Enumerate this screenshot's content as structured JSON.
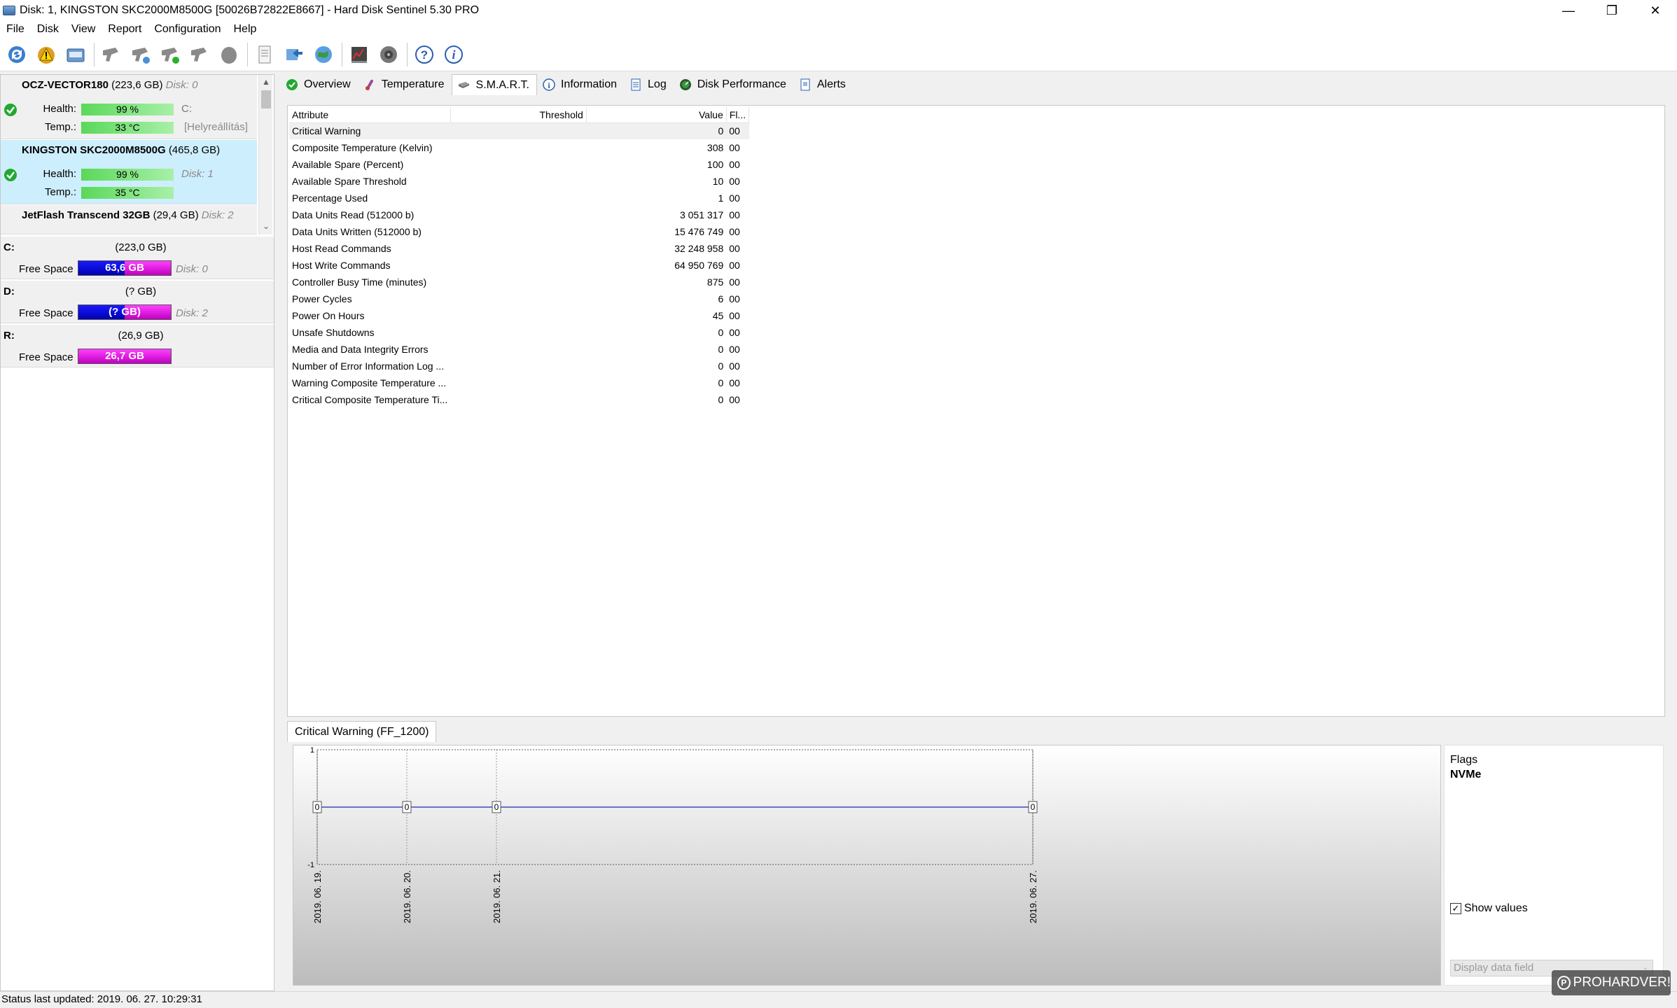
{
  "window": {
    "title": "Disk: 1, KINGSTON SKC2000M8500G [50026B72822E8667]  -  Hard Disk Sentinel 5.30 PRO",
    "minimize": "—",
    "restore": "❐",
    "close": "✕"
  },
  "menu": [
    "File",
    "Disk",
    "View",
    "Report",
    "Configuration",
    "Help"
  ],
  "toolbar_icons": [
    "refresh-icon",
    "warning-icon",
    "disk-icon",
    "sensor-icon",
    "sensor-network-icon",
    "sensor-add-icon",
    "sensor-remove-icon",
    "blob-icon",
    "report-icon",
    "sync-icon",
    "globe-icon",
    "benchmark-icon",
    "speaker-icon",
    "help-icon",
    "info-icon"
  ],
  "disks": [
    {
      "name": "OCZ-VECTOR180",
      "size": "(223,6 GB)",
      "disk": "Disk: 0",
      "health_label": "Health:",
      "health": "99 %",
      "health_fraction": 0.99,
      "temp_label": "Temp.:",
      "temp": "33 °C",
      "note1": "C:",
      "note2": "[Helyreállítás]"
    },
    {
      "name": "KINGSTON SKC2000M8500G",
      "size": "(465,8 GB)",
      "disk": "",
      "health_label": "Health:",
      "health": "99 %",
      "health_fraction": 0.99,
      "temp_label": "Temp.:",
      "temp": "35 °C",
      "note1": "Disk: 1",
      "note2": ""
    },
    {
      "name": "JetFlash Transcend 32GB",
      "size": "(29,4 GB)",
      "disk": "Disk: 2"
    }
  ],
  "volumes": [
    {
      "letter": "C:",
      "size": "(223,0 GB)",
      "free_label": "Free Space",
      "free": "63,6 GB",
      "used_fraction": 0.5,
      "disk": "Disk: 0"
    },
    {
      "letter": "D:",
      "size": "(? GB)",
      "free_label": "Free Space",
      "free": "(? GB)",
      "used_fraction": 0.5,
      "disk": "Disk: 2"
    },
    {
      "letter": "R:",
      "size": "(26,9 GB)",
      "free_label": "Free Space",
      "free": "26,7 GB",
      "used_fraction": 0.0,
      "disk": ""
    }
  ],
  "tabs": [
    "Overview",
    "Temperature",
    "S.M.A.R.T.",
    "Information",
    "Log",
    "Disk Performance",
    "Alerts"
  ],
  "active_tab": "S.M.A.R.T.",
  "smart": {
    "columns": [
      "Attribute",
      "Threshold",
      "Value",
      "Fl..."
    ],
    "rows": [
      [
        "Critical Warning",
        "",
        "0",
        "00"
      ],
      [
        "Composite Temperature (Kelvin)",
        "",
        "308",
        "00"
      ],
      [
        "Available Spare (Percent)",
        "",
        "100",
        "00"
      ],
      [
        "Available Spare Threshold",
        "",
        "10",
        "00"
      ],
      [
        "Percentage Used",
        "",
        "1",
        "00"
      ],
      [
        "Data Units Read (512000 b)",
        "",
        "3 051 317",
        "00"
      ],
      [
        "Data Units Written (512000 b)",
        "",
        "15 476 749",
        "00"
      ],
      [
        "Host Read Commands",
        "",
        "32 248 958",
        "00"
      ],
      [
        "Host Write Commands",
        "",
        "64 950 769",
        "00"
      ],
      [
        "Controller Busy Time (minutes)",
        "",
        "875",
        "00"
      ],
      [
        "Power Cycles",
        "",
        "6",
        "00"
      ],
      [
        "Power On Hours",
        "",
        "45",
        "00"
      ],
      [
        "Unsafe Shutdowns",
        "",
        "0",
        "00"
      ],
      [
        "Media and Data Integrity Errors",
        "",
        "0",
        "00"
      ],
      [
        "Number of Error Information Log ...",
        "",
        "0",
        "00"
      ],
      [
        "Warning Composite Temperature ...",
        "",
        "0",
        "00"
      ],
      [
        "Critical Composite Temperature Ti...",
        "",
        "0",
        "00"
      ]
    ]
  },
  "graph": {
    "tab_label": "Critical Warning (FF_1200)",
    "flags_title": "Flags",
    "flags_value": "NVMe",
    "show_values_label": "Show values",
    "show_values_checked": "✓",
    "data_field_placeholder": "Display data field",
    "dropdown_glyph": "⌄"
  },
  "chart_data": {
    "type": "line",
    "x": [
      "2019. 06. 19.",
      "2019. 06. 20.",
      "2019. 06. 21.",
      "2019. 06. 27."
    ],
    "series": [
      {
        "values": [
          0,
          0,
          0,
          0
        ]
      }
    ],
    "ylim": [
      -1,
      1
    ],
    "yticks": [
      "1",
      "-1"
    ],
    "line_color": "#3c4bb4",
    "grid": true
  },
  "status": {
    "text": "Status last updated: 2019. 06. 27. 10:29:31"
  },
  "watermark": {
    "text": "PROHARDVER!",
    "icon": "P"
  }
}
